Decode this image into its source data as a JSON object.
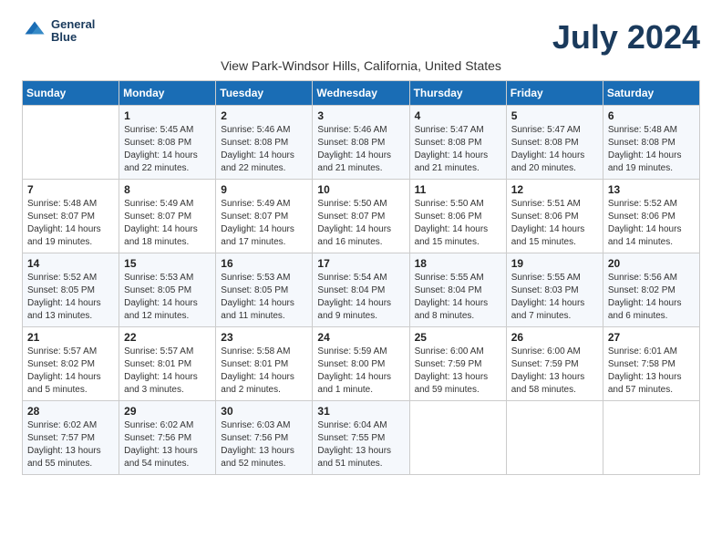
{
  "app": {
    "logo_line1": "General",
    "logo_line2": "Blue"
  },
  "header": {
    "month_title": "July 2024",
    "location": "View Park-Windsor Hills, California, United States"
  },
  "days_of_week": [
    "Sunday",
    "Monday",
    "Tuesday",
    "Wednesday",
    "Thursday",
    "Friday",
    "Saturday"
  ],
  "weeks": [
    [
      {
        "day": "",
        "info": ""
      },
      {
        "day": "1",
        "info": "Sunrise: 5:45 AM\nSunset: 8:08 PM\nDaylight: 14 hours\nand 22 minutes."
      },
      {
        "day": "2",
        "info": "Sunrise: 5:46 AM\nSunset: 8:08 PM\nDaylight: 14 hours\nand 22 minutes."
      },
      {
        "day": "3",
        "info": "Sunrise: 5:46 AM\nSunset: 8:08 PM\nDaylight: 14 hours\nand 21 minutes."
      },
      {
        "day": "4",
        "info": "Sunrise: 5:47 AM\nSunset: 8:08 PM\nDaylight: 14 hours\nand 21 minutes."
      },
      {
        "day": "5",
        "info": "Sunrise: 5:47 AM\nSunset: 8:08 PM\nDaylight: 14 hours\nand 20 minutes."
      },
      {
        "day": "6",
        "info": "Sunrise: 5:48 AM\nSunset: 8:08 PM\nDaylight: 14 hours\nand 19 minutes."
      }
    ],
    [
      {
        "day": "7",
        "info": "Sunrise: 5:48 AM\nSunset: 8:07 PM\nDaylight: 14 hours\nand 19 minutes."
      },
      {
        "day": "8",
        "info": "Sunrise: 5:49 AM\nSunset: 8:07 PM\nDaylight: 14 hours\nand 18 minutes."
      },
      {
        "day": "9",
        "info": "Sunrise: 5:49 AM\nSunset: 8:07 PM\nDaylight: 14 hours\nand 17 minutes."
      },
      {
        "day": "10",
        "info": "Sunrise: 5:50 AM\nSunset: 8:07 PM\nDaylight: 14 hours\nand 16 minutes."
      },
      {
        "day": "11",
        "info": "Sunrise: 5:50 AM\nSunset: 8:06 PM\nDaylight: 14 hours\nand 15 minutes."
      },
      {
        "day": "12",
        "info": "Sunrise: 5:51 AM\nSunset: 8:06 PM\nDaylight: 14 hours\nand 15 minutes."
      },
      {
        "day": "13",
        "info": "Sunrise: 5:52 AM\nSunset: 8:06 PM\nDaylight: 14 hours\nand 14 minutes."
      }
    ],
    [
      {
        "day": "14",
        "info": "Sunrise: 5:52 AM\nSunset: 8:05 PM\nDaylight: 14 hours\nand 13 minutes."
      },
      {
        "day": "15",
        "info": "Sunrise: 5:53 AM\nSunset: 8:05 PM\nDaylight: 14 hours\nand 12 minutes."
      },
      {
        "day": "16",
        "info": "Sunrise: 5:53 AM\nSunset: 8:05 PM\nDaylight: 14 hours\nand 11 minutes."
      },
      {
        "day": "17",
        "info": "Sunrise: 5:54 AM\nSunset: 8:04 PM\nDaylight: 14 hours\nand 9 minutes."
      },
      {
        "day": "18",
        "info": "Sunrise: 5:55 AM\nSunset: 8:04 PM\nDaylight: 14 hours\nand 8 minutes."
      },
      {
        "day": "19",
        "info": "Sunrise: 5:55 AM\nSunset: 8:03 PM\nDaylight: 14 hours\nand 7 minutes."
      },
      {
        "day": "20",
        "info": "Sunrise: 5:56 AM\nSunset: 8:02 PM\nDaylight: 14 hours\nand 6 minutes."
      }
    ],
    [
      {
        "day": "21",
        "info": "Sunrise: 5:57 AM\nSunset: 8:02 PM\nDaylight: 14 hours\nand 5 minutes."
      },
      {
        "day": "22",
        "info": "Sunrise: 5:57 AM\nSunset: 8:01 PM\nDaylight: 14 hours\nand 3 minutes."
      },
      {
        "day": "23",
        "info": "Sunrise: 5:58 AM\nSunset: 8:01 PM\nDaylight: 14 hours\nand 2 minutes."
      },
      {
        "day": "24",
        "info": "Sunrise: 5:59 AM\nSunset: 8:00 PM\nDaylight: 14 hours\nand 1 minute."
      },
      {
        "day": "25",
        "info": "Sunrise: 6:00 AM\nSunset: 7:59 PM\nDaylight: 13 hours\nand 59 minutes."
      },
      {
        "day": "26",
        "info": "Sunrise: 6:00 AM\nSunset: 7:59 PM\nDaylight: 13 hours\nand 58 minutes."
      },
      {
        "day": "27",
        "info": "Sunrise: 6:01 AM\nSunset: 7:58 PM\nDaylight: 13 hours\nand 57 minutes."
      }
    ],
    [
      {
        "day": "28",
        "info": "Sunrise: 6:02 AM\nSunset: 7:57 PM\nDaylight: 13 hours\nand 55 minutes."
      },
      {
        "day": "29",
        "info": "Sunrise: 6:02 AM\nSunset: 7:56 PM\nDaylight: 13 hours\nand 54 minutes."
      },
      {
        "day": "30",
        "info": "Sunrise: 6:03 AM\nSunset: 7:56 PM\nDaylight: 13 hours\nand 52 minutes."
      },
      {
        "day": "31",
        "info": "Sunrise: 6:04 AM\nSunset: 7:55 PM\nDaylight: 13 hours\nand 51 minutes."
      },
      {
        "day": "",
        "info": ""
      },
      {
        "day": "",
        "info": ""
      },
      {
        "day": "",
        "info": ""
      }
    ]
  ]
}
